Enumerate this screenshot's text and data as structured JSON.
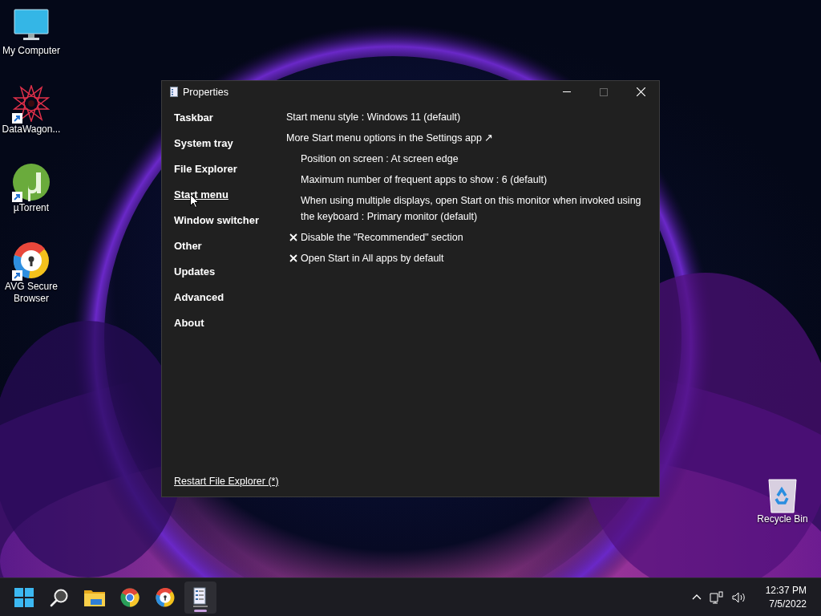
{
  "desktop_icons": [
    {
      "label": "My Computer",
      "kind": "monitor",
      "shortcut": false
    },
    {
      "label": "DataWagon...",
      "kind": "star",
      "shortcut": true
    },
    {
      "label": "µTorrent",
      "kind": "torrent",
      "shortcut": true
    },
    {
      "label": "AVG Secure Browser",
      "kind": "browser",
      "shortcut": true
    }
  ],
  "window": {
    "title": "Properties",
    "sidebar": {
      "items": [
        {
          "label": "Taskbar",
          "selected": false
        },
        {
          "label": "System tray",
          "selected": false
        },
        {
          "label": "File Explorer",
          "selected": false
        },
        {
          "label": "Start menu",
          "selected": true
        },
        {
          "label": "Window switcher",
          "selected": false
        },
        {
          "label": "Other",
          "selected": false
        },
        {
          "label": "Updates",
          "selected": false
        },
        {
          "label": "Advanced",
          "selected": false
        },
        {
          "label": "About",
          "selected": false
        }
      ]
    },
    "settings": [
      {
        "kind": "plain",
        "text": "Start menu style : Windows 11 (default)"
      },
      {
        "kind": "link",
        "text": "More Start menu options in the Settings app ↗"
      },
      {
        "kind": "sub",
        "text": "Position on screen : At screen edge"
      },
      {
        "kind": "sub",
        "text": "Maximum number of frequent apps to show : 6 (default)"
      },
      {
        "kind": "sub",
        "text": "When using multiple displays, open Start on this monitor when invoked using the keyboard : Primary monitor (default)"
      },
      {
        "kind": "check",
        "checked": true,
        "text": "Disable the \"Recommended\" section"
      },
      {
        "kind": "check",
        "checked": true,
        "text": "Open Start in All apps by default"
      }
    ],
    "footer_link": "Restart File Explorer (*)"
  },
  "recycle_bin": {
    "label": "Recycle Bin"
  },
  "taskbar": {
    "apps": [
      {
        "kind": "start",
        "active": false
      },
      {
        "kind": "search",
        "active": false
      },
      {
        "kind": "folder",
        "active": false
      },
      {
        "kind": "chrome",
        "active": false
      },
      {
        "kind": "browser",
        "active": false
      },
      {
        "kind": "properties",
        "active": true
      }
    ],
    "clock": {
      "time": "12:37 PM",
      "date": "7/5/2022"
    }
  }
}
